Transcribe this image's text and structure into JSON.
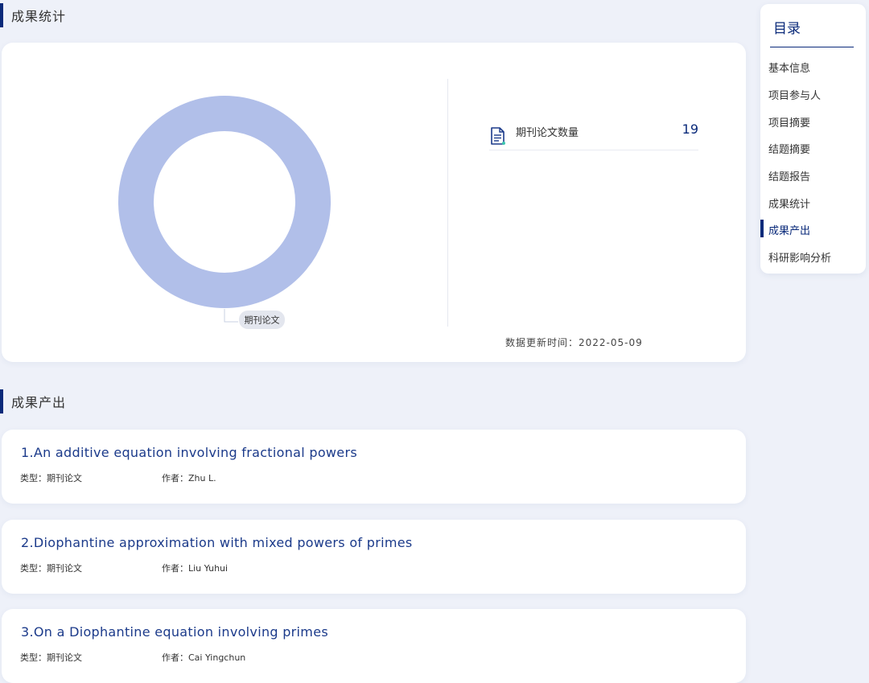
{
  "sections": {
    "stats_title": "成果统计",
    "outputs_title": "成果产出"
  },
  "stats": {
    "journal_label": "期刊论文数量",
    "journal_count": "19",
    "update_text": "数据更新时间：2022-05-09"
  },
  "chart_data": {
    "type": "pie",
    "categories": [
      "期刊论文"
    ],
    "values": [
      19
    ],
    "colors": [
      "#b1bfe9"
    ],
    "title": "",
    "legend": "none"
  },
  "toc": {
    "title": "目录",
    "items": [
      {
        "label": "基本信息"
      },
      {
        "label": "项目参与人"
      },
      {
        "label": "项目摘要"
      },
      {
        "label": "结题摘要"
      },
      {
        "label": "结题报告"
      },
      {
        "label": "成果统计"
      },
      {
        "label": "成果产出"
      },
      {
        "label": "科研影响分析"
      }
    ],
    "active": "成果产出"
  },
  "outputs": [
    {
      "title": "1.An additive equation involving fractional powers",
      "type": "类型：期刊论文",
      "author": "作者：Zhu L."
    },
    {
      "title": "2.Diophantine approximation with mixed powers of primes",
      "type": "类型：期刊论文",
      "author": "作者：Liu Yuhui"
    },
    {
      "title": "3.On a Diophantine equation involving primes",
      "type": "类型：期刊论文",
      "author": "作者：Cai Yingchun"
    }
  ],
  "colors": {
    "accent": "#0a2a7a",
    "donut": "#b1bfe9",
    "background": "#eef1f9"
  }
}
